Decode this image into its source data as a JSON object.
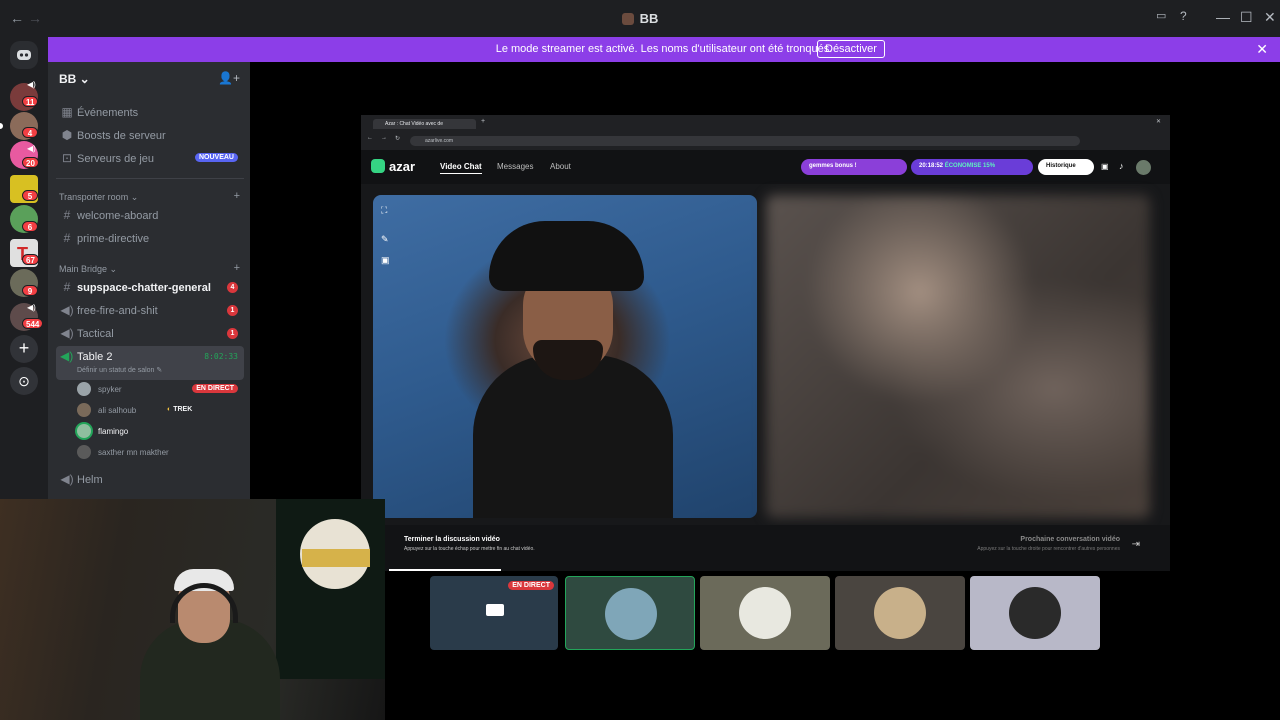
{
  "window": {
    "title": "BB",
    "back": "←",
    "forward": "→",
    "controls": [
      "—",
      "☐",
      "✕"
    ]
  },
  "banner": {
    "text": "Le mode streamer est activé. Les noms d'utilisateur ont été tronqués.",
    "button": "Désactiver",
    "close": "✕"
  },
  "rail": {
    "badges": [
      "11",
      "4",
      "20",
      "5",
      "6",
      "67",
      "9",
      "544"
    ],
    "add_server": "+",
    "discover": "⊙"
  },
  "sidebar": {
    "server_name": "BB ⌄",
    "items": [
      {
        "label": "Événements"
      },
      {
        "label": "Boosts de serveur"
      },
      {
        "label": "Serveurs de jeu",
        "tag": "NOUVEAU"
      }
    ],
    "cat1": {
      "name": "Transporter room ⌄",
      "plus": "+"
    },
    "cat1_channels": [
      "welcome-aboard",
      "prime-directive"
    ],
    "cat2": {
      "name": "Main Bridge ⌄",
      "plus": "+"
    },
    "cat2_channels": [
      {
        "label": "supspace-chatter-general",
        "count": "4"
      },
      {
        "label": "free-fire-and-shit",
        "count": "1"
      },
      {
        "label": "Tactical",
        "count": "1"
      }
    ],
    "voice": {
      "name": "Table 2",
      "time": "8:02:33",
      "status": "Définir un statut de salon ✎"
    },
    "members": [
      {
        "name": "spyker",
        "live": "EN DIRECT"
      },
      {
        "name": "ali salhoub",
        "game": "TREK"
      },
      {
        "name": "flamingo"
      },
      {
        "name": "saxther mn makther"
      }
    ],
    "helm": "Helm"
  },
  "stream": {
    "tab_title": "Azar : Chat Vidéo avec de",
    "url": "azarlive.com",
    "azar": {
      "logo": "azar",
      "nav": [
        "Video Chat",
        "Messages",
        "About"
      ],
      "promo": "gemmes bonus !",
      "timer": "20:18:52",
      "discount": "ÉCONOMISE 15%",
      "history": "Historique",
      "end_title": "Terminer la discussion vidéo",
      "end_sub": "Appuyez sur la touche échap pour mettre fin au chat vidéo.",
      "next_title": "Prochaine conversation vidéo",
      "next_sub": "Appuyez sur la touche droite pour rencontrer d'autres personnes"
    }
  },
  "tiles": {
    "live": "EN DIRECT"
  },
  "colors": {
    "streamer_banner": "#8c3ee8",
    "live_red": "#da373c",
    "voice_green": "#23a55a",
    "azar_green": "#35d483"
  }
}
